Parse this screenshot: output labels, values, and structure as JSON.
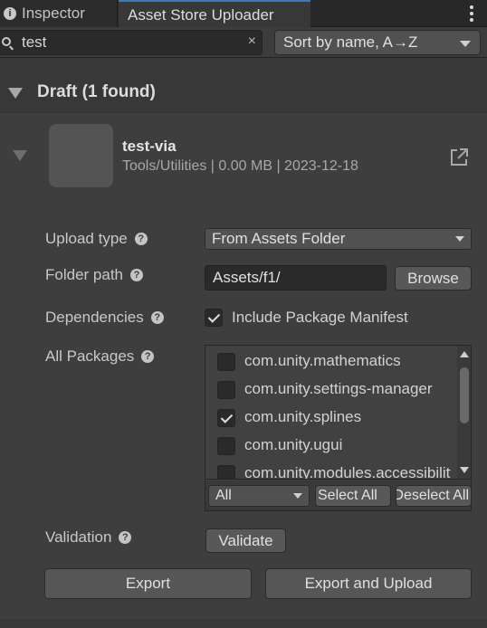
{
  "tabs": [
    {
      "label": "Inspector"
    },
    {
      "label": "Asset Store Uploader"
    }
  ],
  "toolbar": {
    "search_value": "test",
    "clear_glyph": "×",
    "sort_label": "Sort by name, A→Z"
  },
  "draft": {
    "header": "Draft (1 found)"
  },
  "package": {
    "name": "test-via",
    "meta": "Tools/Utilities | 0.00 MB | 2023-12-18"
  },
  "form": {
    "upload_type_label": "Upload type",
    "upload_type_value": "From Assets Folder",
    "folder_path_label": "Folder path",
    "folder_path_value": "Assets/f1/",
    "browse_label": "Browse",
    "dependencies_label": "Dependencies",
    "include_manifest_label": "Include Package Manifest",
    "include_manifest_checked": true,
    "all_packages_label": "All Packages",
    "packages": [
      {
        "name": "com.unity.mathematics",
        "checked": false
      },
      {
        "name": "com.unity.settings-manager",
        "checked": false
      },
      {
        "name": "com.unity.splines",
        "checked": true
      },
      {
        "name": "com.unity.ugui",
        "checked": false
      },
      {
        "name": "com.unity.modules.accessibility",
        "checked": false
      }
    ],
    "filter_value": "All",
    "select_all_label": "Select All",
    "deselect_all_label": "Deselect All",
    "validation_label": "Validation",
    "validate_label": "Validate",
    "help_glyph": "?"
  },
  "actions": {
    "export_label": "Export",
    "export_upload_label": "Export and Upload"
  },
  "icons": {
    "info": "i"
  }
}
